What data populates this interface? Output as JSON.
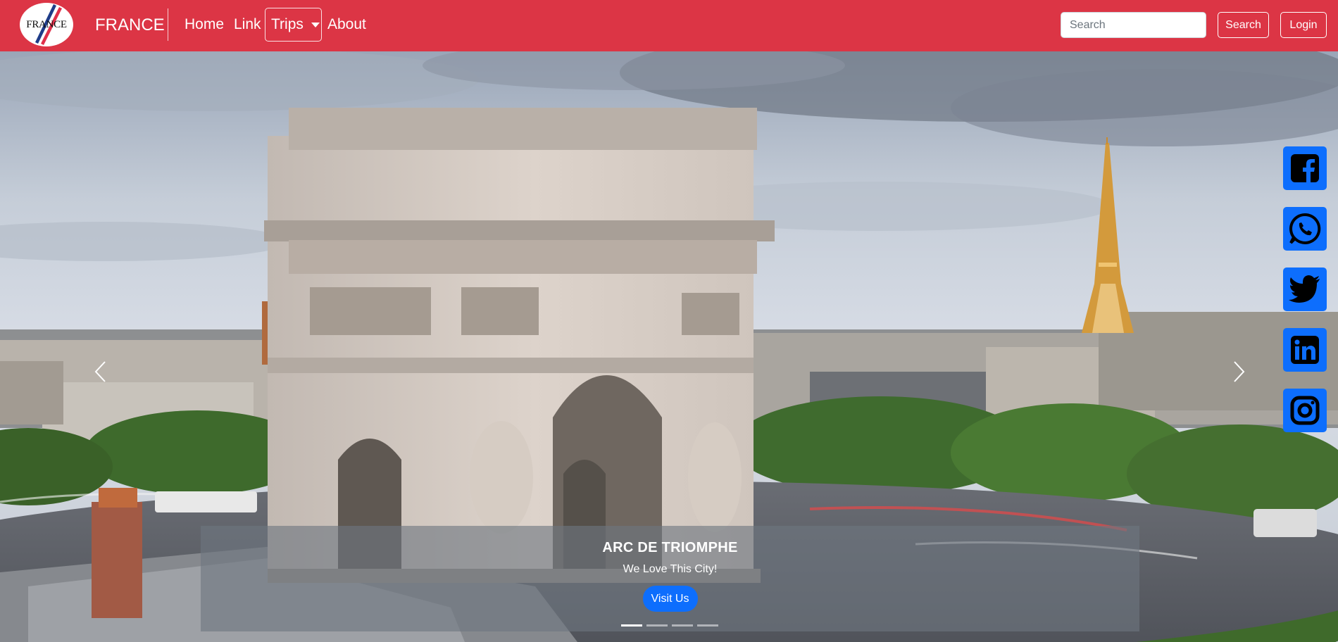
{
  "navbar": {
    "logo_text": "FRANCE",
    "brand": "FRANCE",
    "links": {
      "home": "Home",
      "link": "Link",
      "trips": "Trips",
      "about": "About"
    },
    "search": {
      "placeholder": "Search",
      "value": ""
    },
    "search_button": "Search",
    "login_button": "Login",
    "color": "#dc3545"
  },
  "carousel": {
    "slide": {
      "title": "ARC DE TRIOMPHE",
      "subtitle": "We Love This City!",
      "button": "Visit Us"
    },
    "indicator_count": 4,
    "active_indicator": 1,
    "controls": [
      "chevron-left-icon",
      "chevron-right-icon"
    ]
  },
  "social": {
    "color": "#0d6efd",
    "icons": [
      "facebook-icon",
      "whatsapp-icon",
      "twitter-icon",
      "linkedin-icon",
      "instagram-icon"
    ]
  }
}
